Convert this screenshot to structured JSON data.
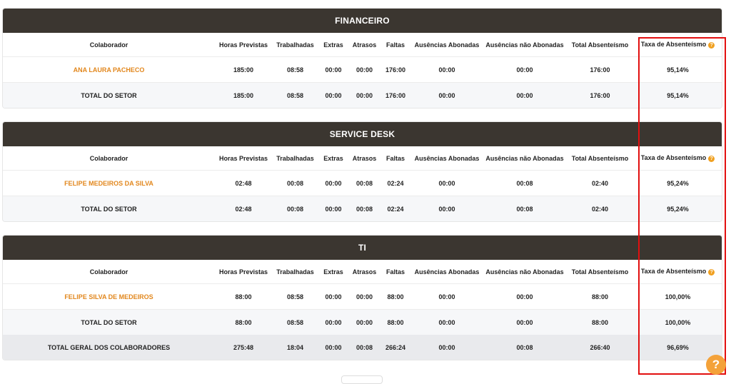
{
  "columns": [
    "Colaborador",
    "Horas Previstas",
    "Trabalhadas",
    "Extras",
    "Atrasos",
    "Faltas",
    "Ausências Abonadas",
    "Ausências não Abonadas",
    "Total Absenteísmo",
    "Taxa de Absenteísmo"
  ],
  "help_glyph": "?",
  "colors": {
    "header_bg": "#3b3630",
    "accent": "#e2871d",
    "highlight": "#e20f0f",
    "help": "#f4a23a"
  },
  "sections": [
    {
      "title": "FINANCEIRO",
      "row": {
        "name": "ANA LAURA PACHECO",
        "horas_previstas": "185:00",
        "trabalhadas": "08:58",
        "extras": "00:00",
        "atrasos": "00:00",
        "faltas": "176:00",
        "aus_abonadas": "00:00",
        "aus_nao_abonadas": "00:00",
        "total_abs": "176:00",
        "taxa": "95,14%"
      },
      "total": {
        "label": "TOTAL DO SETOR",
        "horas_previstas": "185:00",
        "trabalhadas": "08:58",
        "extras": "00:00",
        "atrasos": "00:00",
        "faltas": "176:00",
        "aus_abonadas": "00:00",
        "aus_nao_abonadas": "00:00",
        "total_abs": "176:00",
        "taxa": "95,14%"
      }
    },
    {
      "title": "SERVICE DESK",
      "row": {
        "name": "FELIPE MEDEIROS DA SILVA",
        "horas_previstas": "02:48",
        "trabalhadas": "00:08",
        "extras": "00:00",
        "atrasos": "00:08",
        "faltas": "02:24",
        "aus_abonadas": "00:00",
        "aus_nao_abonadas": "00:08",
        "total_abs": "02:40",
        "taxa": "95,24%"
      },
      "total": {
        "label": "TOTAL DO SETOR",
        "horas_previstas": "02:48",
        "trabalhadas": "00:08",
        "extras": "00:00",
        "atrasos": "00:08",
        "faltas": "02:24",
        "aus_abonadas": "00:00",
        "aus_nao_abonadas": "00:08",
        "total_abs": "02:40",
        "taxa": "95,24%"
      }
    },
    {
      "title": "TI",
      "row": {
        "name": "FELIPE SILVA DE MEDEIROS",
        "horas_previstas": "88:00",
        "trabalhadas": "08:58",
        "extras": "00:00",
        "atrasos": "00:00",
        "faltas": "88:00",
        "aus_abonadas": "00:00",
        "aus_nao_abonadas": "00:00",
        "total_abs": "88:00",
        "taxa": "100,00%"
      },
      "total": {
        "label": "TOTAL DO SETOR",
        "horas_previstas": "88:00",
        "trabalhadas": "08:58",
        "extras": "00:00",
        "atrasos": "00:00",
        "faltas": "88:00",
        "aus_abonadas": "00:00",
        "aus_nao_abonadas": "00:00",
        "total_abs": "88:00",
        "taxa": "100,00%"
      }
    }
  ],
  "grand_total": {
    "label": "TOTAL GERAL DOS COLABORADORES",
    "horas_previstas": "275:48",
    "trabalhadas": "18:04",
    "extras": "00:00",
    "atrasos": "00:08",
    "faltas": "266:24",
    "aus_abonadas": "00:00",
    "aus_nao_abonadas": "00:08",
    "total_abs": "266:40",
    "taxa": "96,69%"
  }
}
